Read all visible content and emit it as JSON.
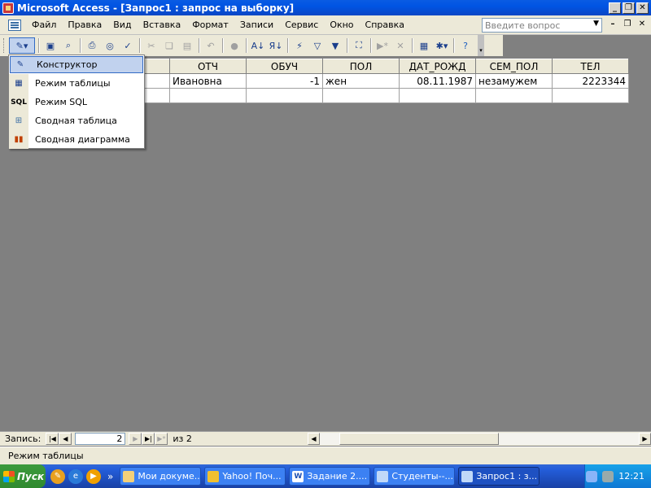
{
  "window": {
    "title": "Microsoft Access - [Запрос1 : запрос на выборку]",
    "btn_minimize": "_",
    "btn_restore": "❐",
    "btn_close": "✕"
  },
  "menu": {
    "items": [
      "Файл",
      "Правка",
      "Вид",
      "Вставка",
      "Формат",
      "Записи",
      "Сервис",
      "Окно",
      "Справка"
    ],
    "ask_placeholder": "Введите вопрос",
    "mdi_minimize": "–",
    "mdi_restore": "❐",
    "mdi_close": "✕"
  },
  "toolbar": {
    "icons": [
      "view-icon",
      "save-icon",
      "search-icon",
      "print-icon",
      "print-preview-icon",
      "spelling-icon",
      "cut-icon",
      "copy-icon",
      "paste-icon",
      "undo-icon",
      "hyperlink-icon",
      "sort-ascending-icon",
      "sort-descending-icon",
      "filter-by-selection-icon",
      "filter-by-form-icon",
      "apply-filter-icon",
      "find-icon",
      "new-record-icon",
      "delete-record-icon",
      "database-window-icon",
      "new-object-icon",
      "help-icon"
    ]
  },
  "view_menu": {
    "items": [
      {
        "label": "Конструктор",
        "icon": "design-view-icon",
        "selected": true
      },
      {
        "label": "Режим таблицы",
        "icon": "datasheet-view-icon",
        "selected": false
      },
      {
        "label": "Режим SQL",
        "icon": "sql-view-icon",
        "selected": false
      },
      {
        "label": "Сводная таблица",
        "icon": "pivottable-icon",
        "selected": false
      },
      {
        "label": "Сводная диаграмма",
        "icon": "pivotchart-icon",
        "selected": false
      }
    ]
  },
  "grid": {
    "columns": [
      "ОТЧ",
      "ОБУЧ",
      "ПОЛ",
      "ДАТ_РОЖД",
      "СЕМ_ПОЛ",
      "ТЕЛ"
    ],
    "rows": [
      [
        "Ивановна",
        "-1",
        "жен",
        "08.11.1987",
        "незамужем",
        "2223344"
      ]
    ]
  },
  "nav": {
    "label": "Запись:",
    "current": "2",
    "of_text": "из  2"
  },
  "status": {
    "text": "Режим таблицы"
  },
  "taskbar": {
    "start": "Пуск",
    "tasks": [
      {
        "label": "Мои докуме...",
        "icon": "folder-icon",
        "active": false
      },
      {
        "label": "Yahoo! Поч...",
        "icon": "browser-icon",
        "active": false
      },
      {
        "label": "Задание 2....",
        "icon": "word-icon",
        "active": false
      },
      {
        "label": "Студенты--...",
        "icon": "window-icon",
        "active": false
      },
      {
        "label": "Запрос1 : з...",
        "icon": "access-icon",
        "active": true
      }
    ],
    "clock": "12:21"
  }
}
